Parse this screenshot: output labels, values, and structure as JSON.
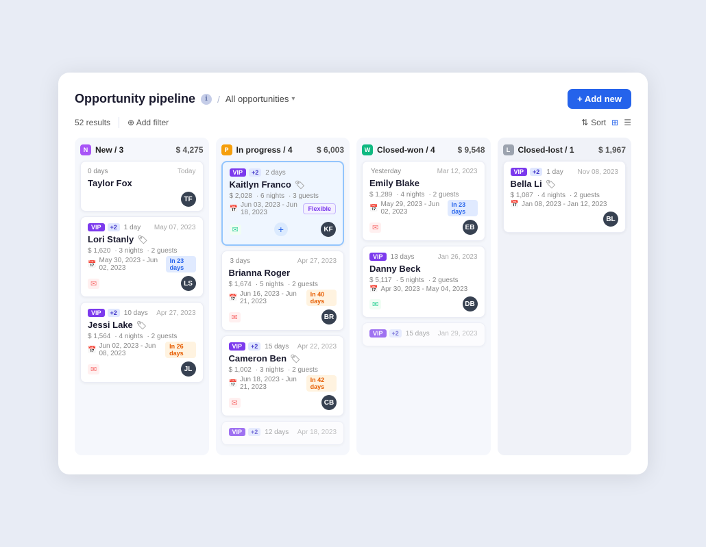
{
  "app": {
    "title": "Opportunity pipeline",
    "breadcrumb": "All opportunities",
    "add_new_label": "+ Add new",
    "results": "52 results",
    "add_filter_label": "⊕ Add filter",
    "sort_label": "Sort",
    "view_grid_label": "⊞",
    "view_list_label": "☰",
    "info_icon": "ℹ"
  },
  "columns": [
    {
      "id": "new",
      "title": "New / 3",
      "amount": "$ 4,275",
      "color": "#a855f7",
      "icon": "N",
      "cards": [
        {
          "type": "first",
          "top_label": "0 days",
          "top_date": "Today",
          "name": "Taylor Fox",
          "avatar_color": "#374151",
          "avatar_initials": "TF"
        },
        {
          "vip": true,
          "plus": "+2",
          "days": "1 day",
          "date": "May 07, 2023",
          "name": "Lori Stanly",
          "has_info_icon": true,
          "amount": "$ 1,620",
          "nights": "3 nights",
          "guests": "2 guests",
          "dates": "May 30, 2023 - Jun 02, 2023",
          "status_pill": "In 23 days",
          "pill_type": "blue",
          "email": true,
          "avatar_color": "#374151",
          "avatar_initials": "LS"
        },
        {
          "vip": true,
          "plus": "+2",
          "days": "10 days",
          "date": "Apr 27, 2023",
          "name": "Jessi Lake",
          "has_info_icon": true,
          "amount": "$ 1,564",
          "nights": "4 nights",
          "guests": "2 guests",
          "dates": "Jun 02, 2023 - Jun 08, 2023",
          "status_pill": "In 26 days",
          "pill_type": "orange",
          "email": true,
          "avatar_color": "#374151",
          "avatar_initials": "JL"
        }
      ]
    },
    {
      "id": "in-progress",
      "title": "In progress / 4",
      "amount": "$ 6,003",
      "color": "#f59e0b",
      "icon": "P",
      "cards": [
        {
          "vip": true,
          "plus": "+2",
          "days": "2 days",
          "date": "",
          "name": "Kaitlyn Franco",
          "has_info_icon": true,
          "amount": "$ 2,028",
          "nights": "6 nights",
          "guests": "3 guests",
          "dates": "Jun 03, 2023 - Jun 18, 2023",
          "status_pill": "Flexible",
          "pill_type": "purple",
          "highlighted": true,
          "email": true,
          "avatar_color": "#374151",
          "avatar_initials": "KF",
          "plus_action": true
        },
        {
          "vip": false,
          "days": "3 days",
          "date": "Apr 27, 2023",
          "name": "Brianna Roger",
          "has_info_icon": false,
          "amount": "$ 1,674",
          "nights": "5 nights",
          "guests": "2 guests",
          "dates": "Jun 16, 2023 - Jun 21, 2023",
          "status_pill": "In 40 days",
          "pill_type": "orange",
          "email": true,
          "avatar_color": "#374151",
          "avatar_initials": "BR"
        },
        {
          "vip": true,
          "plus": "+2",
          "days": "15 days",
          "date": "Apr 22, 2023",
          "name": "Cameron Ben",
          "has_info_icon": true,
          "amount": "$ 1,002",
          "nights": "3 nights",
          "guests": "2 guests",
          "dates": "Jun 18, 2023 - Jun 21, 2023",
          "status_pill": "In 42 days",
          "pill_type": "orange",
          "email": true,
          "avatar_color": "#374151",
          "avatar_initials": "CB"
        },
        {
          "vip": true,
          "plus": "+2",
          "days": "12 days",
          "date": "Apr 18, 2023",
          "name": "",
          "partial": true
        }
      ]
    },
    {
      "id": "closed-won",
      "title": "Closed-won / 4",
      "amount": "$ 9,548",
      "color": "#10b981",
      "icon": "W",
      "cards": [
        {
          "vip": false,
          "days": "Yesterday",
          "date": "",
          "name": "Emily Blake",
          "has_info_icon": false,
          "amount": "$ 1,289",
          "nights": "4 nights",
          "guests": "2 guests",
          "dates": "May 29, 2023 - Jun 02, 2023",
          "status_pill": "In 23 days",
          "pill_type": "blue",
          "email": true,
          "avatar_color": "#374151",
          "avatar_initials": "EB"
        },
        {
          "vip": true,
          "plus": "",
          "days": "13 days",
          "date": "Jan 26, 2023",
          "name": "Danny Beck",
          "has_info_icon": false,
          "amount": "$ 5,117",
          "nights": "5 nights",
          "guests": "2 guests",
          "dates": "Apr 30, 2023 - May 04, 2023",
          "status_pill": "",
          "pill_type": "",
          "email": true,
          "avatar_color": "#374151",
          "avatar_initials": "DB"
        },
        {
          "vip": true,
          "plus": "+2",
          "days": "15 days",
          "date": "Jan 29, 2023",
          "name": "",
          "partial": true
        }
      ]
    },
    {
      "id": "closed-lost",
      "title": "Closed-lost / 1",
      "amount": "$ 1,967",
      "color": "#9ca3af",
      "icon": "L",
      "cards": [
        {
          "vip": true,
          "plus": "+2",
          "days": "1 day",
          "date": "Nov 08, 2023",
          "name": "Bella Li",
          "has_info_icon": true,
          "amount": "$ 1,087",
          "nights": "4 nights",
          "guests": "2 guests",
          "dates": "Jan 08, 2023 - Jan 12, 2023",
          "status_pill": "",
          "pill_type": "",
          "email": false,
          "avatar_color": "#374151",
          "avatar_initials": "BL"
        }
      ]
    }
  ]
}
